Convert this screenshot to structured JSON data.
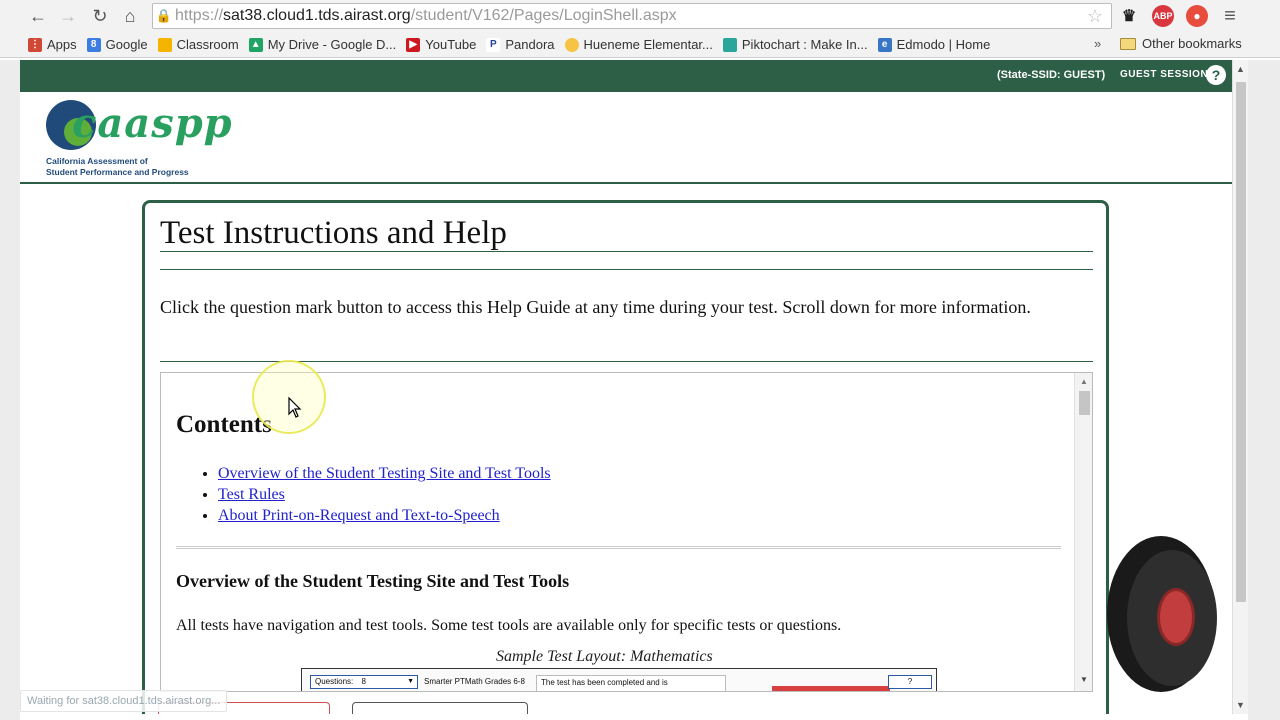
{
  "browser": {
    "url_scheme": "https://",
    "url_host": "sat38.cloud1.tds.airast.org",
    "url_path": "/student/V162/Pages/LoginShell.aspx",
    "extensions": [
      {
        "name": "crown-extension-icon",
        "label": "♛",
        "color": "#222222"
      },
      {
        "name": "adblock-icon",
        "label": "ABP",
        "color": "#d9363e"
      },
      {
        "name": "extension-red-icon",
        "label": "●",
        "color": "#e84c3d"
      }
    ],
    "bookmarks": [
      {
        "label": "Apps",
        "icon": "apps-grid-icon",
        "color": "#d04836"
      },
      {
        "label": "Google",
        "icon": "google-icon",
        "color": "#3b7de0"
      },
      {
        "label": "Classroom",
        "icon": "classroom-icon",
        "color": "#f4b400"
      },
      {
        "label": "My Drive - Google D...",
        "icon": "drive-icon",
        "color": "#1fa463"
      },
      {
        "label": "YouTube",
        "icon": "youtube-icon",
        "color": "#cc181e"
      },
      {
        "label": "Pandora",
        "icon": "pandora-icon",
        "color": "#224099"
      },
      {
        "label": "Hueneme Elementar...",
        "icon": "hueneme-icon",
        "color": "#f6c343"
      },
      {
        "label": "Piktochart : Make In...",
        "icon": "piktochart-icon",
        "color": "#2aa59a"
      },
      {
        "label": "Edmodo | Home",
        "icon": "edmodo-icon",
        "color": "#3876c5"
      }
    ],
    "more_label": "»",
    "other_bookmarks": "Other bookmarks",
    "status_text": "Waiting for sat38.cloud1.tds.airast.org..."
  },
  "site": {
    "ssid_text": "(State-SSID: GUEST)",
    "session_text": "GUEST SESSION",
    "help_label": "?",
    "logo_text": "caaspp",
    "logo_sub_line1": "California Assessment of",
    "logo_sub_line2": "Student Performance and Progress"
  },
  "card": {
    "title": "Test Instructions and Help",
    "intro": "Click the question mark button to access this Help Guide at any time during your test. Scroll down for more information."
  },
  "help": {
    "contents_heading": "Contents",
    "toc": [
      "Overview of the Student Testing Site and Test Tools",
      "Test Rules",
      "About Print-on-Request and Text-to-Speech"
    ],
    "overview_heading": "Overview of the Student Testing Site and Test Tools",
    "overview_text": "All tests have navigation and test tools. Some test tools are available only for specific tests or questions.",
    "caption": "Sample Test Layout: Mathematics",
    "sample": {
      "questions_label": "Questions:",
      "questions_value": "8",
      "title": "Smarter PTMath Grades 6-8",
      "message": "The test has been completed and is",
      "help": "?"
    }
  }
}
